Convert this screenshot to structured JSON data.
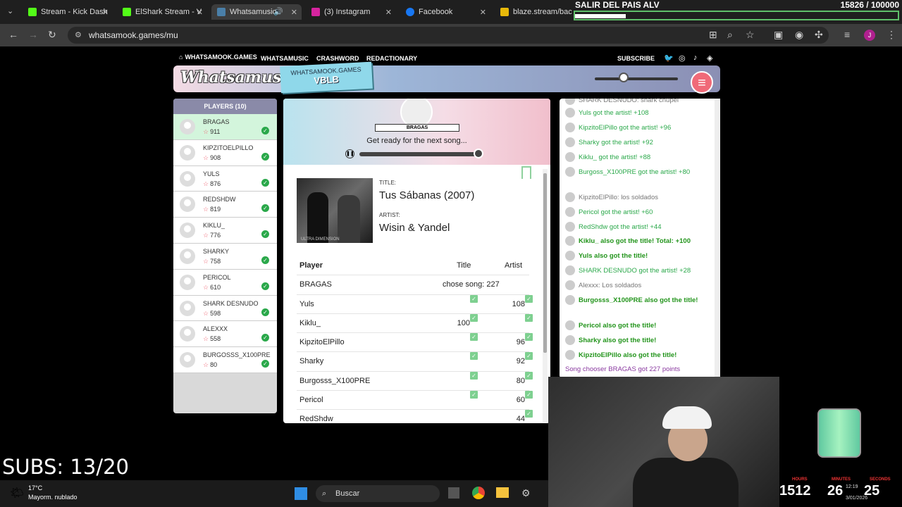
{
  "browser": {
    "tabs": [
      {
        "label": "Stream - Kick Dash",
        "color": "#53fc18"
      },
      {
        "label": "ElShark Stream - V",
        "color": "#53fc18"
      },
      {
        "label": "Whatsamusic",
        "color": "#4a7fa8"
      },
      {
        "label": "(3) Instagram",
        "color": "#d6249f"
      },
      {
        "label": "Facebook",
        "color": "#1877f2"
      },
      {
        "label": "blaze.stream/back",
        "color": "#e8b90a"
      }
    ],
    "url": "whatsamook.games/mu"
  },
  "site_nav": {
    "home": "WHATSAMOOK.GAMES",
    "items": [
      "WHATSAMUSIC",
      "CRASHWORD",
      "REDACTIONARY"
    ],
    "subscribe": "SUBSCRIBE"
  },
  "header": {
    "logo": "Whatsamusic",
    "badge_small": "WHATSAMOOK.GAMES",
    "badge_code": "VBLB",
    "volume": 0.35
  },
  "players": {
    "title": "PLAYERS (10)",
    "list": [
      {
        "name": "BRAGAS",
        "points": "911"
      },
      {
        "name": "KIPZITOELPILLO",
        "points": "908"
      },
      {
        "name": "YULS",
        "points": "876"
      },
      {
        "name": "REDSHDW",
        "points": "819"
      },
      {
        "name": "KIKLU_",
        "points": "776"
      },
      {
        "name": "SHARKY",
        "points": "758"
      },
      {
        "name": "PERICOL",
        "points": "610"
      },
      {
        "name": "SHARK DESNUDO",
        "points": "598"
      },
      {
        "name": "ALEXXX",
        "points": "558"
      },
      {
        "name": "BURGOSSS_X100PRE",
        "points": "80"
      }
    ]
  },
  "song": {
    "chooser": "BRAGAS",
    "status": "Get ready for the next song...",
    "progress": 0.95,
    "title_label": "TITLE:",
    "title": "Tus Sábanas (2007)",
    "artist_label": "ARTIST:",
    "artist": "Wisin & Yandel",
    "cover_text": "ULTRA DIMENSION"
  },
  "results": {
    "headers": [
      "Player",
      "Title",
      "Artist"
    ],
    "rows": [
      {
        "player": "BRAGAS",
        "title": "",
        "artist": "chose song: 227"
      },
      {
        "player": "Yuls",
        "title": "✓",
        "artist": "108 ✓"
      },
      {
        "player": "Kiklu_",
        "title": "100 ✓",
        "artist": "✓"
      },
      {
        "player": "KipzitoElPillo",
        "title": "✓",
        "artist": "96 ✓"
      },
      {
        "player": "Sharky",
        "title": "✓",
        "artist": "92 ✓"
      },
      {
        "player": "Burgosss_X100PRE",
        "title": "✓",
        "artist": "80 ✓"
      },
      {
        "player": "Pericol",
        "title": "✓",
        "artist": "60 ✓"
      },
      {
        "player": "RedShdw",
        "title": "",
        "artist": "44 ✓"
      }
    ]
  },
  "chat": [
    "SHARK DESNUDO: shark chupel",
    "Yuls got the artist! +108",
    "KipzitoElPillo got the artist! +96",
    "Sharky got the artist! +92",
    "Kiklu_ got the artist! +88",
    "Burgoss_X100PRE got the artist! +80",
    "KipzitoElPillo: los soldados",
    "Pericol got the artist! +60",
    "RedShdw got the artist! +44",
    "Kiklu_ also got the title! Total: +100",
    "Yuls also got the title!",
    "SHARK DESNUDO got the artist! +28",
    "Alexxx: Los soldados",
    "Burgosss_X100PRE also got the title!",
    "Pericol also got the title!",
    "Sharky also got the title!",
    "KipzitoElPillo also got the title!",
    "Song chooser BRAGAS got 227 points"
  ],
  "stream": {
    "goal_title": "SALIR DEL PAIS ALV",
    "goal_count": "15826 / 100000",
    "goal_fraction": 0.158,
    "subs": "SUBS: 13/20",
    "timer_hours": "1512",
    "timer_minutes": "26",
    "timer_seconds": "25",
    "label_hours": "HOURS",
    "label_minutes": "MINUTES",
    "label_seconds": "SECONDS"
  },
  "taskbar": {
    "weather_temp": "17°C",
    "weather_desc": "Mayorm. nublado",
    "search": "Buscar",
    "time": "12:19",
    "date": "3/01/2026"
  },
  "colors": {
    "accent": "#f06a78",
    "green": "#2aa84a",
    "header_purple": "#8b8fb4"
  }
}
